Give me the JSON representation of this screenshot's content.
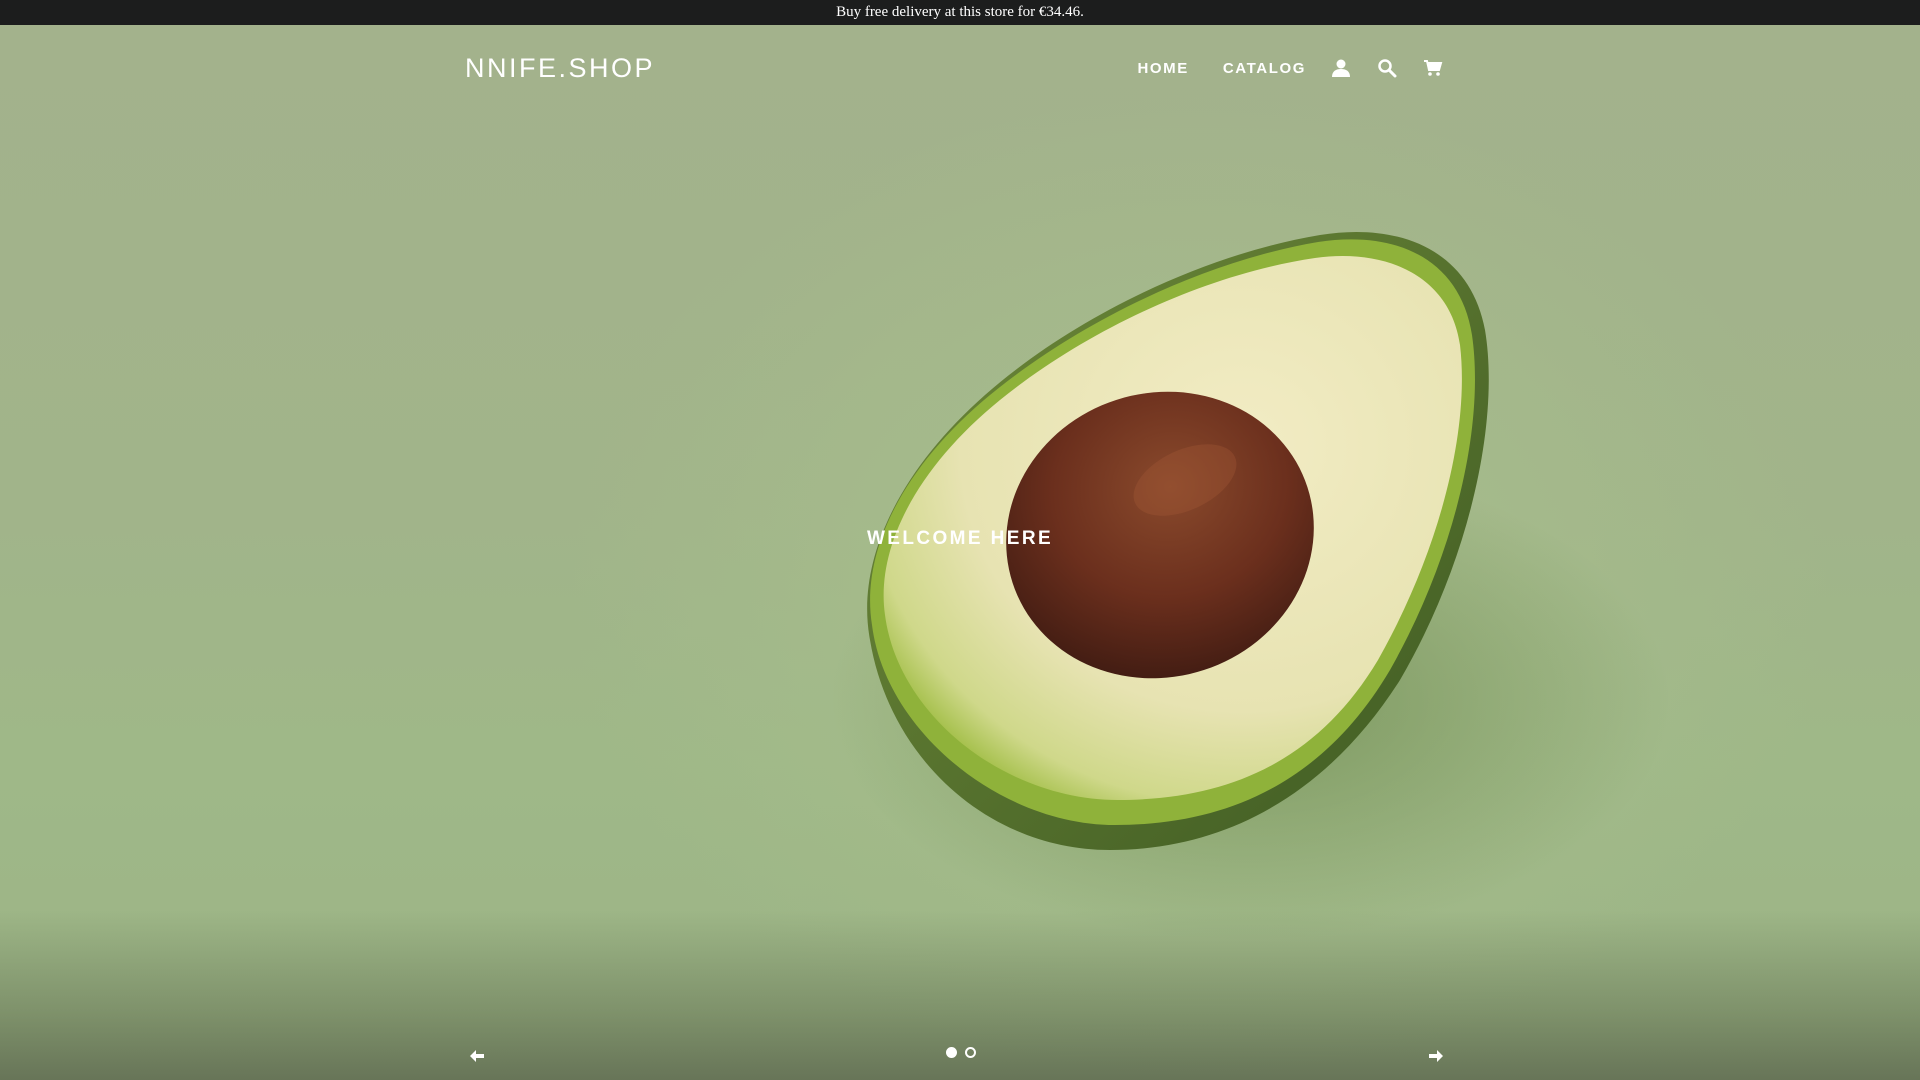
{
  "announcement": {
    "text": "Buy free delivery at this store for €34.46."
  },
  "header": {
    "logo": "NNIFE.SHOP",
    "nav": [
      {
        "label": "HOME"
      },
      {
        "label": "CATALOG"
      }
    ],
    "icons": [
      "account-icon",
      "search-icon",
      "cart-icon"
    ]
  },
  "hero": {
    "title": "WELCOME HERE",
    "slides": {
      "count": 2,
      "active": 1
    }
  },
  "colors": {
    "announcement_bg": "#1c1d1d",
    "hero_bg": "#a5b58c",
    "avocado_skin": "#4f6a2c",
    "avocado_flesh": "#e6e2b4",
    "avocado_pit": "#6a2f1e"
  }
}
